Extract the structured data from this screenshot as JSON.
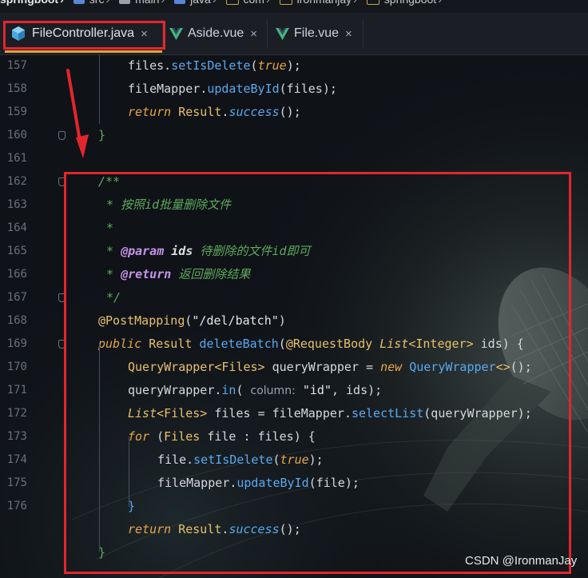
{
  "breadcrumb": [
    {
      "label": "springboot"
    },
    {
      "label": "src"
    },
    {
      "label": "main"
    },
    {
      "label": "java"
    },
    {
      "label": "com"
    },
    {
      "label": "ironmanjay"
    },
    {
      "label": "springboot"
    }
  ],
  "tabs": [
    {
      "label": "FileController.java",
      "close": "×",
      "active": true
    },
    {
      "label": "Aside.vue",
      "close": "×"
    },
    {
      "label": "File.vue",
      "close": "×"
    }
  ],
  "line_numbers": [
    "157",
    "158",
    "159",
    "160",
    "161",
    "162",
    "163",
    "164",
    "165",
    "166",
    "167",
    "168",
    "169",
    "170",
    "171",
    "172",
    "173",
    "174",
    "175",
    "176"
  ],
  "code": {
    "l157": {
      "obj": "files",
      "dot": ".",
      "method": "setIsDelete",
      "open": "(",
      "arg": "true",
      "close": ");"
    },
    "l158": {
      "obj": "fileMapper",
      "dot": ".",
      "method": "updateById",
      "rest": "(files);"
    },
    "l159": {
      "kw": "return",
      "cls": "Result",
      "dot": ".",
      "method": "success",
      "rest": "();"
    },
    "l160": {
      "brace": "}"
    },
    "l162": {
      "text": "/**"
    },
    "l163": {
      "star": "*",
      "text": "按照id批量删除文件"
    },
    "l164": {
      "star": "*"
    },
    "l165": {
      "star": "*",
      "tag": "@param",
      "param": "ids",
      "text": "待删除的文件id即可"
    },
    "l166": {
      "star": "*",
      "tag": "@return",
      "text": "返回删除结果"
    },
    "l167": {
      "text": "*/"
    },
    "l168": {
      "ann": "@PostMapping",
      "open": "(",
      "str": "\"/del/batch\"",
      "close": ")"
    },
    "l169": {
      "kw": "public",
      "type": "Result",
      "method": "deleteBatch",
      "open": "(",
      "ann": "@RequestBody",
      "list": "List",
      "generic": "<Integer>",
      "param": "ids",
      "rest": ") {"
    },
    "l170": {
      "type": "QueryWrapper",
      "generic": "<Files>",
      "var": "queryWrapper",
      "eq": "=",
      "kw": "new",
      "ctor": "QueryWrapper",
      "diamond": "<>",
      "rest": "();"
    },
    "l171": {
      "obj": "queryWrapper",
      "dot": ".",
      "method": "in",
      "open": "(",
      "hint": "column:",
      "str": "\"id\"",
      "rest": ", ids);"
    },
    "l172": {
      "list": "List",
      "generic": "<Files>",
      "var": "files",
      "eq": "=",
      "obj": "fileMapper",
      "dot": ".",
      "method": "selectList",
      "rest": "(queryWrapper);"
    },
    "l173": {
      "kw": "for",
      "open": "(",
      "type": "Files",
      "var": "file",
      "colon": ":",
      "iter": "files",
      "rest": ") {"
    },
    "l174": {
      "obj": "file",
      "dot": ".",
      "method": "setIsDelete",
      "open": "(",
      "arg": "true",
      "close": ");"
    },
    "l175": {
      "obj": "fileMapper",
      "dot": ".",
      "method": "updateById",
      "open": "(",
      "arg": "file",
      "close": ");"
    },
    "l176": {
      "brace": "}"
    },
    "l177": {
      "kw": "return",
      "cls": "Result",
      "dot": ".",
      "method": "success",
      "rest": "();"
    },
    "l178": {
      "brace": "}"
    }
  },
  "watermark": "CSDN @IronmanJay",
  "colors": {
    "highlight_box": "#e3262d",
    "active_tab_underline": "#e8a33a",
    "java_icon": "#4aa8e0",
    "vue_icon": "#41b883"
  }
}
